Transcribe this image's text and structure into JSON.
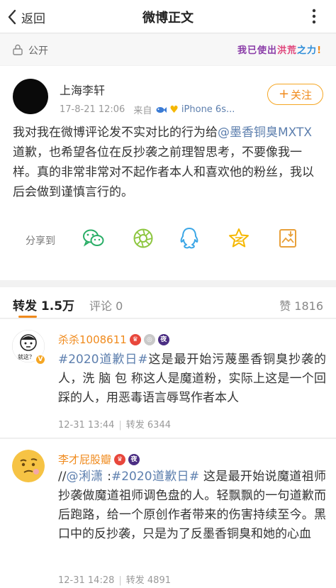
{
  "nav": {
    "back_label": "返回",
    "title": "微博正文"
  },
  "privacy": {
    "label": "公开",
    "badge_parts": [
      "我已使出",
      "洪荒",
      "之力",
      "!"
    ]
  },
  "post": {
    "author": "上海李轩",
    "time": "17-8-21 12:06",
    "from_label": "来自",
    "device": "iPhone 6s...",
    "follow_label": "关注",
    "text_before": "我对我在微博评论发不实对比的行为给",
    "mention": "@墨香铜臭MXTX",
    "text_after": " 道歉，也希望各位在反抄袭之前理智思考，不要像我一样。真的非常非常对不起作者本人和喜欢他的粉丝，我以后会做到谨慎言行的。"
  },
  "share": {
    "label": "分享到",
    "icons": [
      "wechat-icon",
      "moments-icon",
      "qq-icon",
      "qzone-icon",
      "save-image-icon"
    ]
  },
  "tabs": {
    "repost": "转发 1.5万",
    "comment": "评论 0",
    "like": "赞 1816"
  },
  "comments": [
    {
      "name": "杀杀1008611",
      "hashtag": "#2020道歉日#",
      "text": "这是最开始污蔑墨香铜臭抄袭的人，洗 脑 包 称这人是魔道粉，实际上这是一个回踩的人，用恶毒语言辱骂作者本人",
      "time": "12-31 13:44",
      "repost": "转发 6344",
      "avatar_caption": "就这？"
    },
    {
      "name": "李才屁股瓣",
      "prefix": "//",
      "mention": "@浰潇",
      "separator": " :",
      "hashtag": "#2020道歉日#",
      "text": " 这是最开始说魔道祖师抄袭做魔道祖师调色盘的人。轻飘飘的一句道歉而后跑路，给一个原创作者带来的伤害持续至今。黑口中的反抄袭，只是为了反墨香铜臭和她的心血",
      "time": "12-31 14:28",
      "repost": "转发 4891"
    }
  ]
}
